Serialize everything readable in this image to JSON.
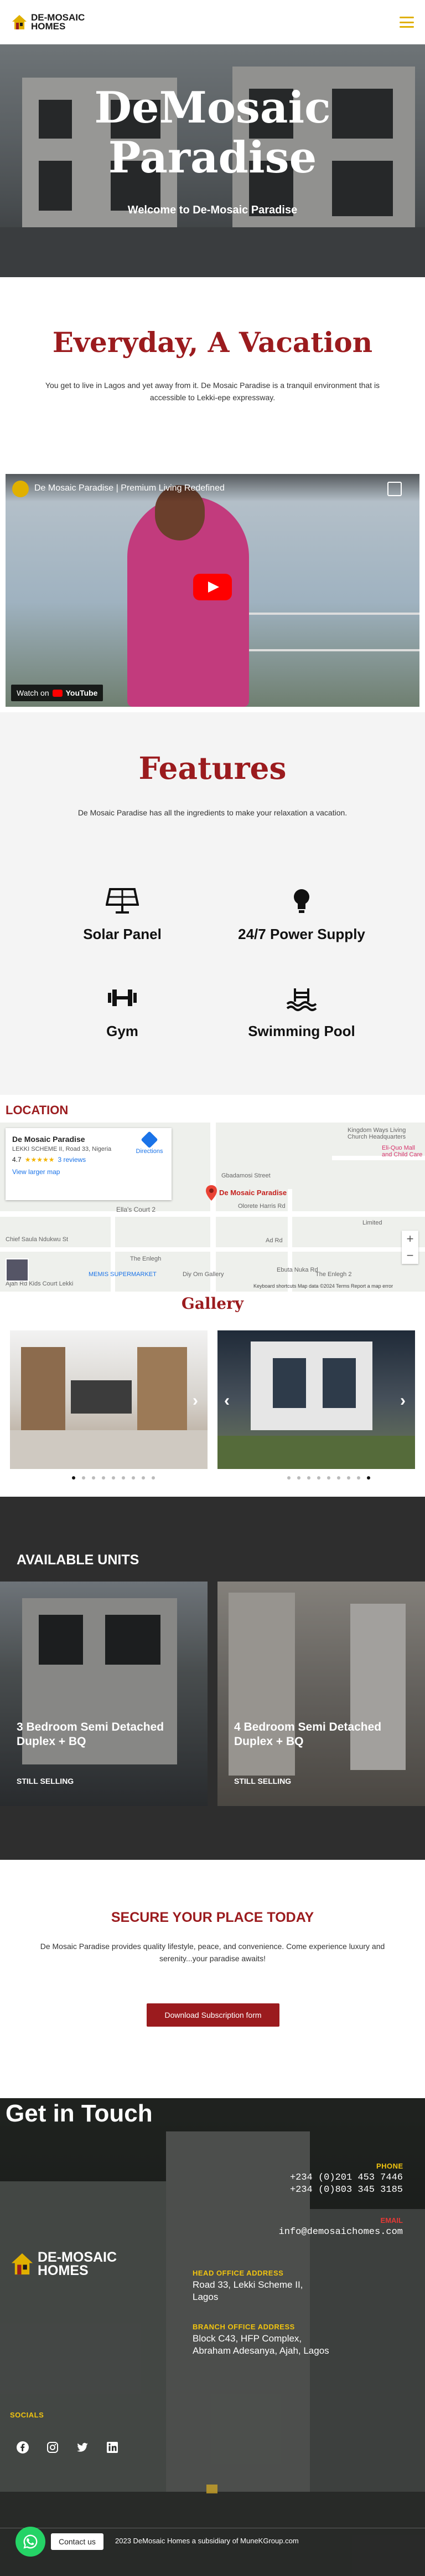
{
  "header": {
    "logo_line1": "DE-MOSAIC",
    "logo_line2": "HOMES"
  },
  "hero": {
    "title": "DeMosaic Paradise",
    "subtitle": "Welcome to De-Mosaic Paradise"
  },
  "intro": {
    "title": "Everyday, A Vacation",
    "text": "You get to live in Lagos and yet away from it. De Mosaic Paradise is a tranquil environment that is accessible to Lekki-epe expressway."
  },
  "video": {
    "title": "De Mosaic Paradise | Premium Living Redefined",
    "watch_on": "Watch on",
    "brand": "YouTube"
  },
  "features": {
    "title": "Features",
    "text": "De Mosaic Paradise has all the ingredients to make your relaxation a vacation.",
    "items": [
      {
        "label": "Solar Panel",
        "icon": "solar-panel-icon"
      },
      {
        "label": "24/7 Power Supply",
        "icon": "bulb-icon"
      },
      {
        "label": "Gym",
        "icon": "dumbbell-icon"
      },
      {
        "label": "Swimming Pool",
        "icon": "pool-icon"
      }
    ]
  },
  "location": {
    "title": "LOCATION",
    "place_name": "De Mosaic Paradise",
    "address": "LEKKI SCHEME II, Road 33, Nigeria",
    "rating": "4.7",
    "reviews": "3 reviews",
    "larger_map": "View larger map",
    "directions": "Directions",
    "pin_label": "De Mosaic Paradise",
    "labels": [
      "Kingdom Ways Living Church Headquarters",
      "Ella's Court 2",
      "Olorete Harris Rd",
      "Ad Rd",
      "The Enlegh",
      "MEMIS SUPERMARKET",
      "Diy Om Gallery",
      "The Enlegh 2",
      "Ebuta Nuka Rd",
      "Limited",
      "Eli-Quo Mall and Child Care",
      "Gbadamosi Street",
      "Chief Saula Ndukwu St",
      "Ajah Rd Kids Court Lekki"
    ],
    "footer": "Keyboard shortcuts   Map data ©2024   Terms   Report a map error"
  },
  "gallery": {
    "title": "Gallery",
    "dots": 9,
    "active_dot_left": 0,
    "active_dot_right": 8
  },
  "units": {
    "title": "AVAILABLE UNITS",
    "items": [
      {
        "title": "3 Bedroom Semi Detached Duplex + BQ",
        "status": "STILL SELLING"
      },
      {
        "title": "4 Bedroom Semi Detached Duplex + BQ",
        "status": "STILL SELLING"
      }
    ]
  },
  "secure": {
    "title": "SECURE YOUR PLACE TODAY",
    "text": "De Mosaic Paradise provides quality lifestyle, peace, and convenience. Come experience luxury and serenity...your paradise awaits!",
    "button": "Download Subscription form"
  },
  "contact": {
    "title": "Get in Touch",
    "phone_label": "PHONE",
    "phone1": "+234 (0)201 453 7446",
    "phone2": "+234 (0)803 345 3185",
    "email_label": "EMAIL",
    "email": "info@demosaichomes.com",
    "head_office_label": "HEAD OFFICE ADDRESS",
    "head_office_line1": "Road 33, Lekki Scheme II,",
    "head_office_line2": "Lagos",
    "branch_label": "BRANCH OFFICE ADDRESS",
    "branch_line1": "Block C43, HFP Complex,",
    "branch_line2": "Abraham Adesanya, Ajah, Lagos",
    "socials_label": "SOCIALS",
    "copyright": "2023 DeMosaic Homes a subsidiary of MuneKGroup.com",
    "contact_us": "Contact us"
  },
  "colors": {
    "brand_red": "#9b1b1e",
    "accent_yellow": "#f1c40f",
    "whatsapp": "#25d366"
  }
}
